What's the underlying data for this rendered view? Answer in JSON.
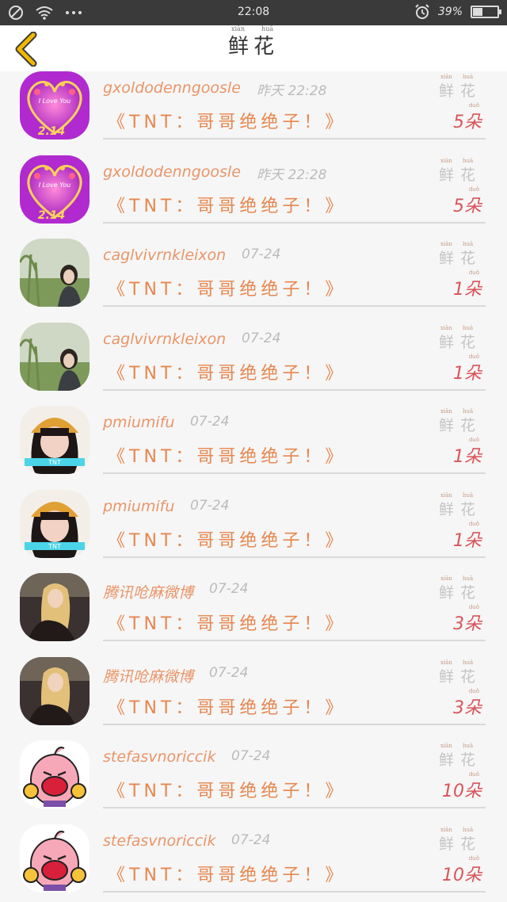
{
  "status_bar": {
    "time": "22:08",
    "battery": "39%",
    "battery_level": 0.39,
    "icons": [
      "no-sim-icon",
      "wifi-icon",
      "more-icon",
      "alarm-icon",
      "battery-icon"
    ]
  },
  "header": {
    "title": "鲜花",
    "title_pinyin": [
      "xiān",
      "huā"
    ],
    "back_icon": "chevron-left-icon"
  },
  "colors": {
    "name": "#e99568",
    "message": "#e6874f",
    "count": "#d9545a",
    "label": "#c4c4c4",
    "back": "#f0b800"
  },
  "items": [
    {
      "name": "gxoldodenngoosle",
      "time": "昨天 22:28",
      "message": "《TNT：哥哥绝绝子！》",
      "count": "5朵",
      "label": "鲜花",
      "avatar": "valentine-heart"
    },
    {
      "name": "gxoldodenngoosle",
      "time": "昨天 22:28",
      "message": "《TNT：哥哥绝绝子！》",
      "count": "5朵",
      "label": "鲜花",
      "avatar": "valentine-heart"
    },
    {
      "name": "caglvivrnkleixon",
      "time": "07-24",
      "message": "《TNT：哥哥绝绝子！》",
      "count": "1朵",
      "label": "鲜花",
      "avatar": "garden-girl"
    },
    {
      "name": "caglvivrnkleixon",
      "time": "07-24",
      "message": "《TNT：哥哥绝绝子！》",
      "count": "1朵",
      "label": "鲜花",
      "avatar": "garden-girl"
    },
    {
      "name": "pmiumifu",
      "time": "07-24",
      "message": "《TNT：哥哥绝绝子！》",
      "count": "1朵",
      "label": "鲜花",
      "avatar": "beanie-girl"
    },
    {
      "name": "pmiumifu",
      "time": "07-24",
      "message": "《TNT：哥哥绝绝子！》",
      "count": "1朵",
      "label": "鲜花",
      "avatar": "beanie-girl"
    },
    {
      "name": "腾讯呛麻微博",
      "time": "07-24",
      "message": "《TNT：哥哥绝绝子！》",
      "count": "3朵",
      "label": "鲜花",
      "avatar": "blonde-woman"
    },
    {
      "name": "腾讯呛麻微博",
      "time": "07-24",
      "message": "《TNT：哥哥绝绝子！》",
      "count": "3朵",
      "label": "鲜花",
      "avatar": "blonde-woman"
    },
    {
      "name": "stefasvnoriccik",
      "time": "07-24",
      "message": "《TNT：哥哥绝绝子！》",
      "count": "10朵",
      "label": "鲜花",
      "avatar": "cartoon-buu"
    },
    {
      "name": "stefasvnoriccik",
      "time": "07-24",
      "message": "《TNT：哥哥绝绝子！》",
      "count": "10朵",
      "label": "鲜花",
      "avatar": "cartoon-buu"
    }
  ]
}
